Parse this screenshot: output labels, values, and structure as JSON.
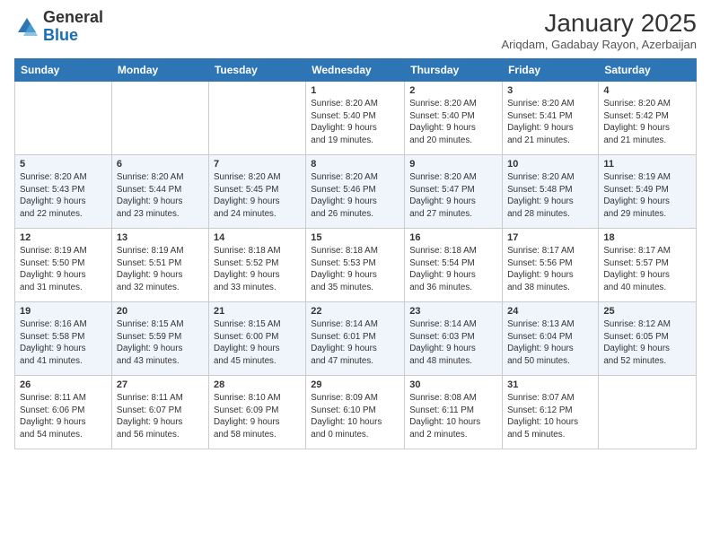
{
  "logo": {
    "general": "General",
    "blue": "Blue"
  },
  "header": {
    "month": "January 2025",
    "location": "Ariqdam, Gadabay Rayon, Azerbaijan"
  },
  "days_of_week": [
    "Sunday",
    "Monday",
    "Tuesday",
    "Wednesday",
    "Thursday",
    "Friday",
    "Saturday"
  ],
  "weeks": [
    [
      {
        "day": "",
        "info": ""
      },
      {
        "day": "",
        "info": ""
      },
      {
        "day": "",
        "info": ""
      },
      {
        "day": "1",
        "info": "Sunrise: 8:20 AM\nSunset: 5:40 PM\nDaylight: 9 hours\nand 19 minutes."
      },
      {
        "day": "2",
        "info": "Sunrise: 8:20 AM\nSunset: 5:40 PM\nDaylight: 9 hours\nand 20 minutes."
      },
      {
        "day": "3",
        "info": "Sunrise: 8:20 AM\nSunset: 5:41 PM\nDaylight: 9 hours\nand 21 minutes."
      },
      {
        "day": "4",
        "info": "Sunrise: 8:20 AM\nSunset: 5:42 PM\nDaylight: 9 hours\nand 21 minutes."
      }
    ],
    [
      {
        "day": "5",
        "info": "Sunrise: 8:20 AM\nSunset: 5:43 PM\nDaylight: 9 hours\nand 22 minutes."
      },
      {
        "day": "6",
        "info": "Sunrise: 8:20 AM\nSunset: 5:44 PM\nDaylight: 9 hours\nand 23 minutes."
      },
      {
        "day": "7",
        "info": "Sunrise: 8:20 AM\nSunset: 5:45 PM\nDaylight: 9 hours\nand 24 minutes."
      },
      {
        "day": "8",
        "info": "Sunrise: 8:20 AM\nSunset: 5:46 PM\nDaylight: 9 hours\nand 26 minutes."
      },
      {
        "day": "9",
        "info": "Sunrise: 8:20 AM\nSunset: 5:47 PM\nDaylight: 9 hours\nand 27 minutes."
      },
      {
        "day": "10",
        "info": "Sunrise: 8:20 AM\nSunset: 5:48 PM\nDaylight: 9 hours\nand 28 minutes."
      },
      {
        "day": "11",
        "info": "Sunrise: 8:19 AM\nSunset: 5:49 PM\nDaylight: 9 hours\nand 29 minutes."
      }
    ],
    [
      {
        "day": "12",
        "info": "Sunrise: 8:19 AM\nSunset: 5:50 PM\nDaylight: 9 hours\nand 31 minutes."
      },
      {
        "day": "13",
        "info": "Sunrise: 8:19 AM\nSunset: 5:51 PM\nDaylight: 9 hours\nand 32 minutes."
      },
      {
        "day": "14",
        "info": "Sunrise: 8:18 AM\nSunset: 5:52 PM\nDaylight: 9 hours\nand 33 minutes."
      },
      {
        "day": "15",
        "info": "Sunrise: 8:18 AM\nSunset: 5:53 PM\nDaylight: 9 hours\nand 35 minutes."
      },
      {
        "day": "16",
        "info": "Sunrise: 8:18 AM\nSunset: 5:54 PM\nDaylight: 9 hours\nand 36 minutes."
      },
      {
        "day": "17",
        "info": "Sunrise: 8:17 AM\nSunset: 5:56 PM\nDaylight: 9 hours\nand 38 minutes."
      },
      {
        "day": "18",
        "info": "Sunrise: 8:17 AM\nSunset: 5:57 PM\nDaylight: 9 hours\nand 40 minutes."
      }
    ],
    [
      {
        "day": "19",
        "info": "Sunrise: 8:16 AM\nSunset: 5:58 PM\nDaylight: 9 hours\nand 41 minutes."
      },
      {
        "day": "20",
        "info": "Sunrise: 8:15 AM\nSunset: 5:59 PM\nDaylight: 9 hours\nand 43 minutes."
      },
      {
        "day": "21",
        "info": "Sunrise: 8:15 AM\nSunset: 6:00 PM\nDaylight: 9 hours\nand 45 minutes."
      },
      {
        "day": "22",
        "info": "Sunrise: 8:14 AM\nSunset: 6:01 PM\nDaylight: 9 hours\nand 47 minutes."
      },
      {
        "day": "23",
        "info": "Sunrise: 8:14 AM\nSunset: 6:03 PM\nDaylight: 9 hours\nand 48 minutes."
      },
      {
        "day": "24",
        "info": "Sunrise: 8:13 AM\nSunset: 6:04 PM\nDaylight: 9 hours\nand 50 minutes."
      },
      {
        "day": "25",
        "info": "Sunrise: 8:12 AM\nSunset: 6:05 PM\nDaylight: 9 hours\nand 52 minutes."
      }
    ],
    [
      {
        "day": "26",
        "info": "Sunrise: 8:11 AM\nSunset: 6:06 PM\nDaylight: 9 hours\nand 54 minutes."
      },
      {
        "day": "27",
        "info": "Sunrise: 8:11 AM\nSunset: 6:07 PM\nDaylight: 9 hours\nand 56 minutes."
      },
      {
        "day": "28",
        "info": "Sunrise: 8:10 AM\nSunset: 6:09 PM\nDaylight: 9 hours\nand 58 minutes."
      },
      {
        "day": "29",
        "info": "Sunrise: 8:09 AM\nSunset: 6:10 PM\nDaylight: 10 hours\nand 0 minutes."
      },
      {
        "day": "30",
        "info": "Sunrise: 8:08 AM\nSunset: 6:11 PM\nDaylight: 10 hours\nand 2 minutes."
      },
      {
        "day": "31",
        "info": "Sunrise: 8:07 AM\nSunset: 6:12 PM\nDaylight: 10 hours\nand 5 minutes."
      },
      {
        "day": "",
        "info": ""
      }
    ]
  ]
}
